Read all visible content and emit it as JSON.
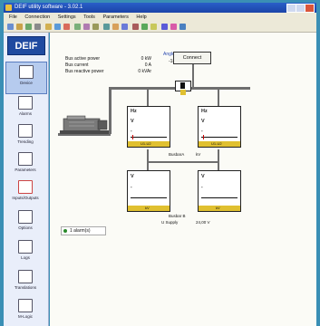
{
  "window": {
    "title": "DEIF utility software - 3.02.1"
  },
  "menu": [
    "File",
    "Connection",
    "Settings",
    "Tools",
    "Parameters",
    "Help"
  ],
  "sidebar": {
    "logo": "DEIF",
    "items": [
      {
        "label": "Device",
        "icon": "device-icon",
        "active": true
      },
      {
        "label": "Alarms",
        "icon": "alarm-icon",
        "active": false
      },
      {
        "label": "Trending",
        "icon": "trending-icon",
        "active": false
      },
      {
        "label": "Parameters",
        "icon": "parameters-icon",
        "active": false
      },
      {
        "label": "Inputs/Outputs",
        "icon": "io-icon",
        "active": false
      },
      {
        "label": "Options",
        "icon": "options-icon",
        "active": false
      },
      {
        "label": "Logs",
        "icon": "logs-icon",
        "active": false
      },
      {
        "label": "Translations",
        "icon": "translations-icon",
        "active": false
      },
      {
        "label": "M-Logic",
        "icon": "mlogic-icon",
        "active": false
      }
    ]
  },
  "measurements": {
    "rows": [
      {
        "label": "Bus active power",
        "value": "0 kW"
      },
      {
        "label": "Bus current",
        "value": "0 A"
      },
      {
        "label": "Bus reactive power",
        "value": "0 kVAr"
      }
    ]
  },
  "angle": {
    "title": "Angle diff.",
    "value": "-180 °"
  },
  "connect_button": "Connect",
  "meters": {
    "gen": {
      "hz": "Hz",
      "v": "V",
      "value": "-",
      "footer": "U1-U2"
    },
    "bus": {
      "hz": "Hz",
      "v": "V",
      "value": "-",
      "footer": "U1-U2"
    },
    "busA": {
      "v": "V",
      "value": "-",
      "footer": "kV"
    },
    "busB": {
      "v": "V",
      "value": "-",
      "footer": "kV"
    }
  },
  "labels": {
    "busbar_a": "BusbarA",
    "busbar_b": "Busbar B",
    "bus_kv": "kV",
    "supply": "U Supply",
    "supply_value": "24,00 V"
  },
  "alarm_panel": {
    "text": "1 alarm(s)"
  },
  "colors": {
    "accent": "#1f4aa0",
    "meter_footer": "#e0c030",
    "bus_line": "#6e6e6e"
  }
}
